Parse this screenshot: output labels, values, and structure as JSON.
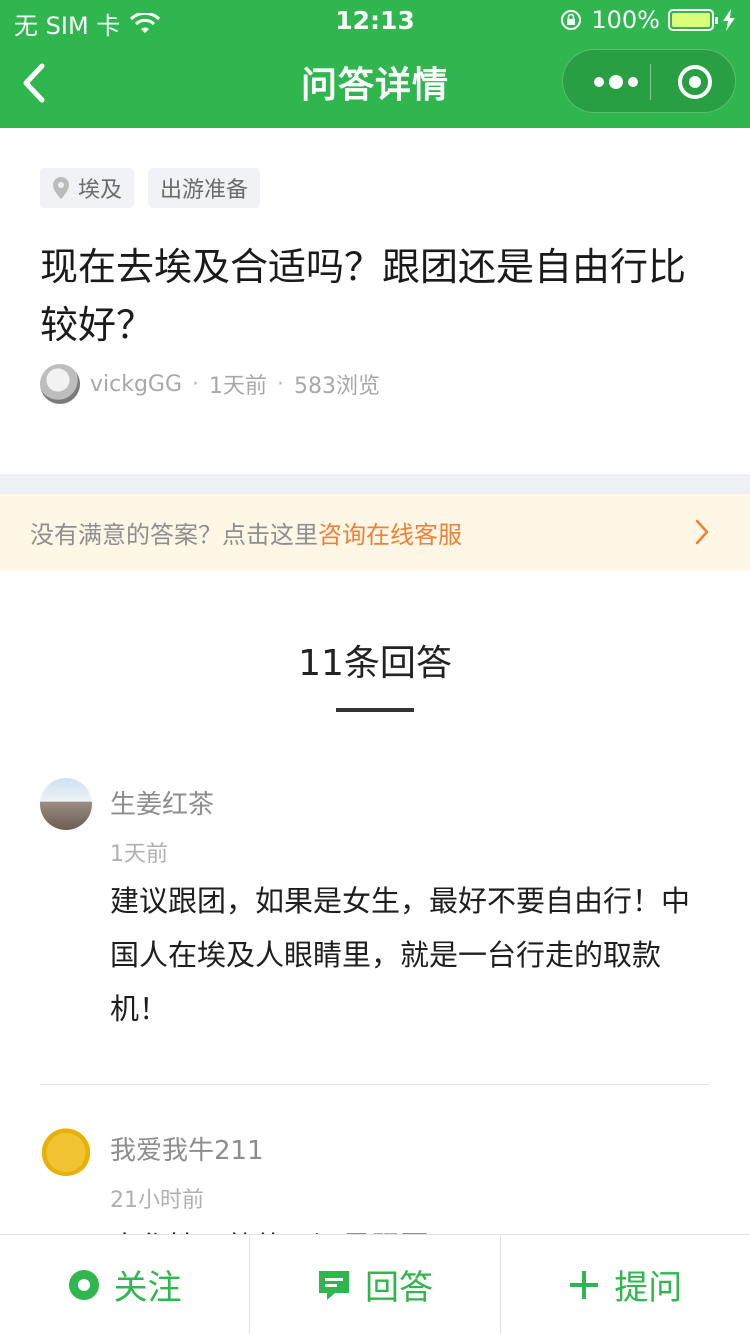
{
  "status_bar": {
    "carrier": "无 SIM 卡",
    "time": "12:13",
    "battery_percent": "100%",
    "battery_level": 1.0
  },
  "nav": {
    "title": "问答详情",
    "back_icon": "chevron-left-icon",
    "more_icon": "more-dots-icon",
    "close_icon": "target-circle-icon"
  },
  "question": {
    "tags": [
      {
        "label": "埃及",
        "icon": "location-pin-icon"
      },
      {
        "label": "出游准备"
      }
    ],
    "title": "现在去埃及合适吗？跟团还是自由行比较好？",
    "author": "vickgGG",
    "time": "1天前",
    "views": "583浏览"
  },
  "banner": {
    "hint": "没有满意的答案？点击这里",
    "link": "咨询在线客服"
  },
  "answers_header": {
    "count_label": "11条回答"
  },
  "answers": [
    {
      "name": "生姜红茶",
      "time": "1天前",
      "text": "建议跟团，如果是女生，最好不要自由行！中国人在埃及人眼睛里，就是一台行走的取款机！"
    },
    {
      "name": "我爱我牛211",
      "time": "21小时前",
      "text": "大华性不熟的，还是跟团吧"
    }
  ],
  "bottom_bar": {
    "follow": "关注",
    "answer": "回答",
    "ask": "提问"
  },
  "colors": {
    "brand_green": "#2fb64e",
    "link_orange": "#f08036"
  }
}
